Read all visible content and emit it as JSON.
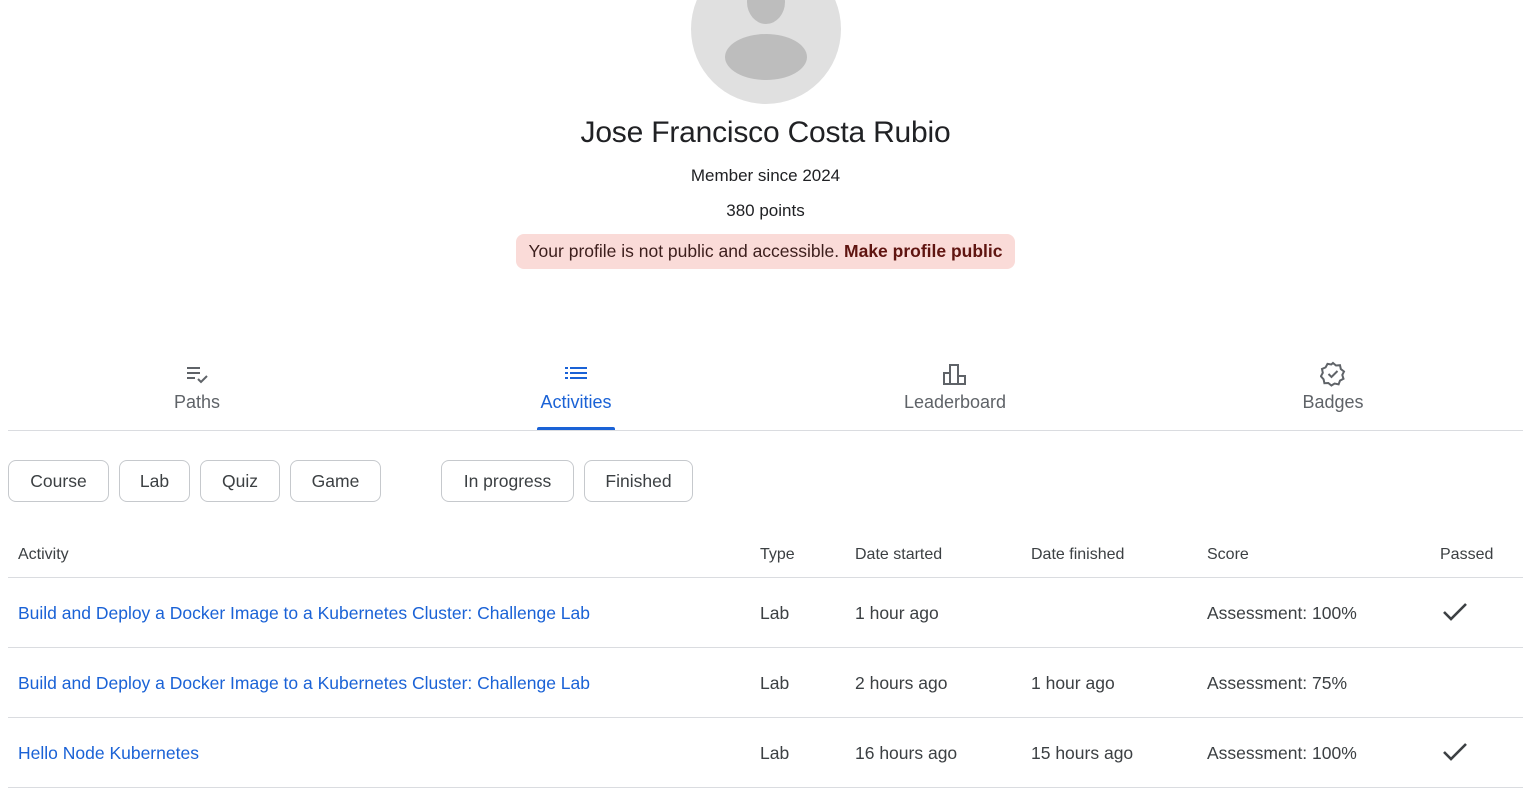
{
  "profile": {
    "name": "Jose Francisco Costa Rubio",
    "member_since": "Member since 2024",
    "points": "380 points",
    "privacy_message": "Your profile is not public and accessible.",
    "privacy_action": "Make profile public"
  },
  "tabs": [
    {
      "label": "Paths",
      "icon": "paths-checklist-icon",
      "active": false
    },
    {
      "label": "Activities",
      "icon": "list-icon",
      "active": true
    },
    {
      "label": "Leaderboard",
      "icon": "leaderboard-icon",
      "active": false
    },
    {
      "label": "Badges",
      "icon": "badge-verified-icon",
      "active": false
    }
  ],
  "filters": {
    "type": [
      "Course",
      "Lab",
      "Quiz",
      "Game"
    ],
    "status": [
      "In progress",
      "Finished"
    ]
  },
  "table": {
    "headers": {
      "activity": "Activity",
      "type": "Type",
      "date_started": "Date started",
      "date_finished": "Date finished",
      "score": "Score",
      "passed": "Passed"
    },
    "rows": [
      {
        "activity": "Build and Deploy a Docker Image to a Kubernetes Cluster: Challenge Lab",
        "type": "Lab",
        "date_started": "1 hour ago",
        "date_finished": "",
        "score": "Assessment: 100%",
        "passed": true
      },
      {
        "activity": "Build and Deploy a Docker Image to a Kubernetes Cluster: Challenge Lab",
        "type": "Lab",
        "date_started": "2 hours ago",
        "date_finished": "1 hour ago",
        "score": "Assessment: 75%",
        "passed": false
      },
      {
        "activity": "Hello Node Kubernetes",
        "type": "Lab",
        "date_started": "16 hours ago",
        "date_finished": "15 hours ago",
        "score": "Assessment: 100%",
        "passed": true
      }
    ]
  },
  "colors": {
    "accent": "#1a62d6",
    "banner_bg": "#fadbd8",
    "avatar_bg": "#e0e0e0",
    "divider": "#dadce0"
  }
}
